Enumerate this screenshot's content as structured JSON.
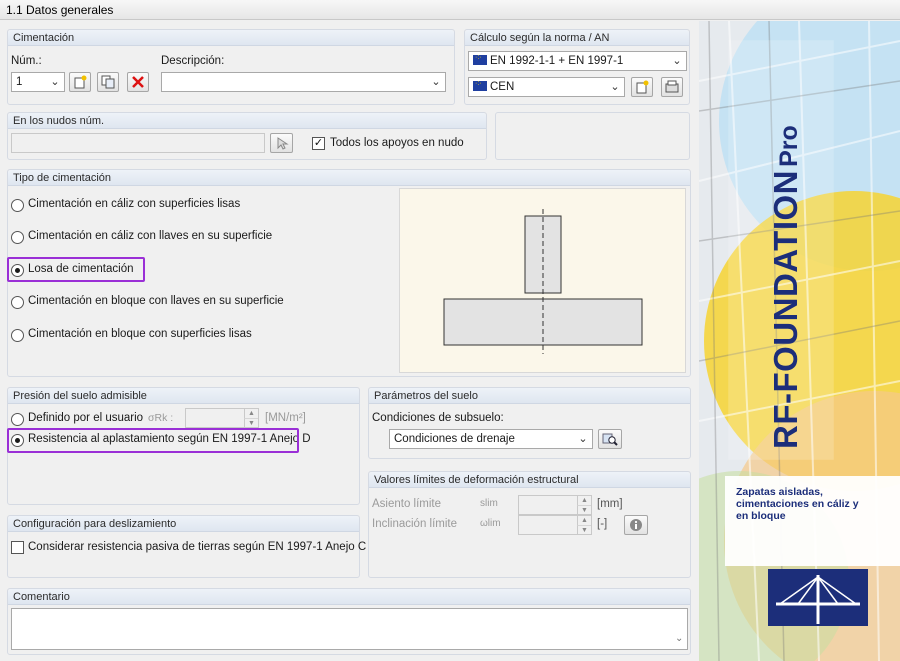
{
  "window": {
    "title": "1.1 Datos generales"
  },
  "foundation": {
    "section_title": "Cimentación",
    "num_label": "Núm.:",
    "num_value": "1",
    "description_label": "Descripción:",
    "description_value": ""
  },
  "calculation": {
    "section_title": "Cálculo según la norma / AN",
    "standard_value": "EN 1992-1-1 + EN 1997-1",
    "annex_value": "CEN"
  },
  "nodes": {
    "section_title": "En los nudos núm.",
    "nodes_value": "",
    "all_supports_label": "Todos los apoyos en nudo",
    "all_supports_checked": true
  },
  "foundation_type": {
    "section_title": "Tipo de cimentación",
    "options": [
      {
        "label": "Cimentación en cáliz con superficies lisas",
        "selected": false
      },
      {
        "label": "Cimentación en cáliz con llaves en su superficie",
        "selected": false
      },
      {
        "label": "Losa de cimentación",
        "selected": true
      },
      {
        "label": "Cimentación en bloque con llaves en su superficie",
        "selected": false
      },
      {
        "label": "Cimentación en bloque con superficies lisas",
        "selected": false
      }
    ]
  },
  "soil_pressure": {
    "section_title": "Presión del suelo admisible",
    "user_defined_label": "Definido por el usuario",
    "sigma_label": "σRk :",
    "sigma_value": "",
    "sigma_unit": "[MN/m²]",
    "resistance_label": "Resistencia al aplastamiento según EN 1997-1 Anejo D",
    "selected": "resistance"
  },
  "soil_params": {
    "section_title": "Parámetros del suelo",
    "subsoil_label": "Condiciones de subsuelo:",
    "subsoil_value": "Condiciones de drenaje"
  },
  "deformation": {
    "section_title": "Valores límites de deformación estructural",
    "settlement_label": "Asiento límite",
    "settlement_symbol": "slim",
    "settlement_value": "",
    "settlement_unit": "[mm]",
    "tilt_label": "Inclinación límite",
    "tilt_symbol": "ωlim",
    "tilt_value": "",
    "tilt_unit": "[-]"
  },
  "sliding": {
    "section_title": "Configuración para deslizamiento",
    "passive_label": "Considerar resistencia pasiva de tierras según EN 1997-1 Anejo C",
    "passive_checked": false
  },
  "comment": {
    "section_title": "Comentario",
    "value": ""
  },
  "branding": {
    "product_name": "RF-FOUNDATION",
    "product_suffix": "Pro",
    "tagline": "Zapatas aisladas, cimentaciones en cáliz y en bloque",
    "brand_color": "#1c2e7a"
  }
}
